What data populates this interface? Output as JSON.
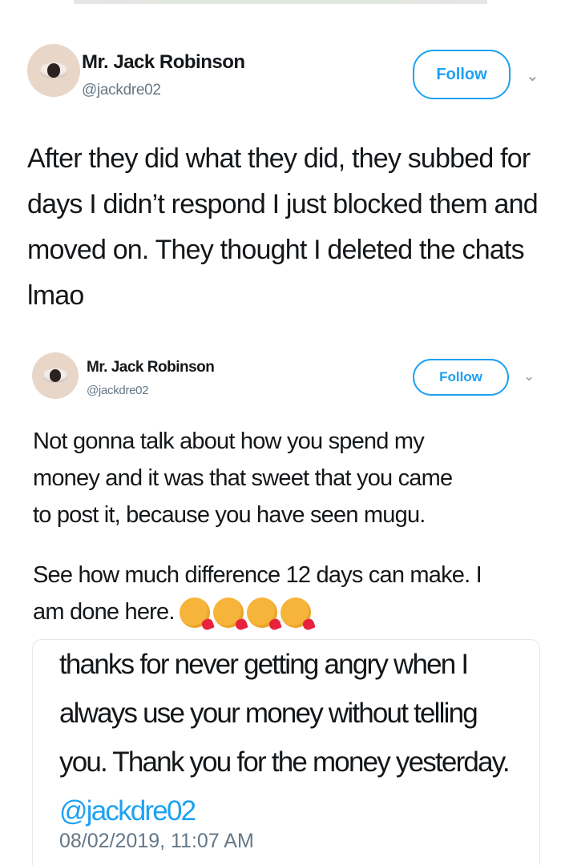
{
  "tweets": [
    {
      "author_name": "Mr. Jack Robinson",
      "handle": "@jackdre02",
      "follow_label": "Follow",
      "text": "After they did what they did, they subbed for\ndays I didn’t respond I just blocked them and\nmoved on. They thought I deleted the chats\nlmao"
    },
    {
      "author_name": "Mr. Jack Robinson",
      "handle": "@jackdre02",
      "follow_label": "Follow",
      "text_p1": "Not gonna talk about how you spend my\nmoney and it was that sweet that you came\nto post it, because you have seen mugu.",
      "text_p2": "See how much difference 12 days can make. I\nam done here.",
      "emojis": [
        "kissing-face-with-heart-icon",
        "kissing-face-with-heart-icon",
        "kissing-face-with-heart-icon",
        "kissing-face-with-heart-icon"
      ]
    }
  ],
  "quoted": {
    "text": "thanks for never getting angry when I\nalways use your money without telling\nyou. Thank you for the money yesterday.",
    "mention": "@jackdre02",
    "timestamp": "08/02/2019, 11:07 AM"
  },
  "colors": {
    "accent": "#1da1f2",
    "muted": "#657786",
    "text": "#14171a"
  }
}
